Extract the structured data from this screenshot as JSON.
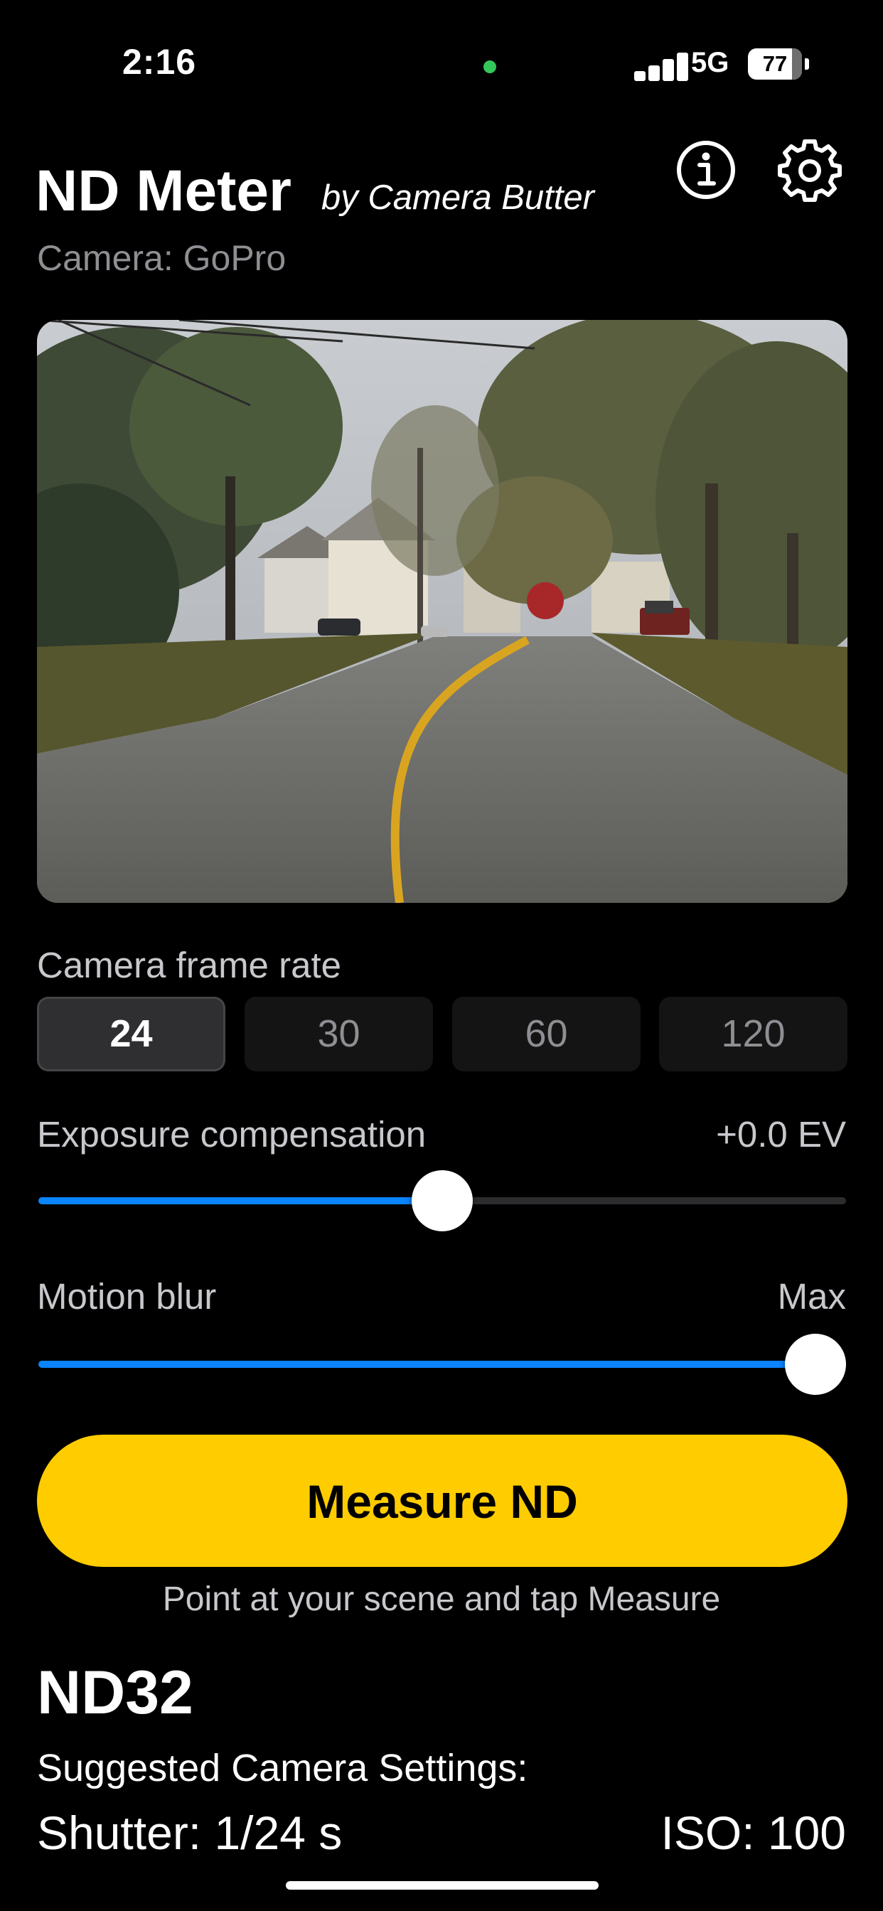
{
  "status_bar": {
    "time": "2:16",
    "network": "5G",
    "battery": "77"
  },
  "header": {
    "title": "ND Meter",
    "byline": "by Camera Butter",
    "camera": "Camera: GoPro",
    "info_icon": "info-circle-icon",
    "settings_icon": "gear-icon"
  },
  "preview": {
    "icon": "camera-preview-street-scene"
  },
  "frame_rate": {
    "label": "Camera frame rate",
    "options": [
      "24",
      "30",
      "60",
      "120"
    ],
    "selected": "24"
  },
  "exposure": {
    "label": "Exposure compensation",
    "value": "+0.0 EV",
    "slider_fraction": 0.5
  },
  "motion_blur": {
    "label": "Motion blur",
    "value": "Max",
    "slider_fraction": 1.0
  },
  "measure": {
    "button_label": "Measure ND",
    "hint": "Point at your scene and tap Measure"
  },
  "result": {
    "nd": "ND32",
    "suggested_label": "Suggested Camera Settings:",
    "shutter": "Shutter: 1/24 s",
    "iso": "ISO: 100"
  },
  "colors": {
    "accent": "#0a84ff",
    "measure_button": "#ffcc00",
    "status_dot": "#34c759"
  }
}
